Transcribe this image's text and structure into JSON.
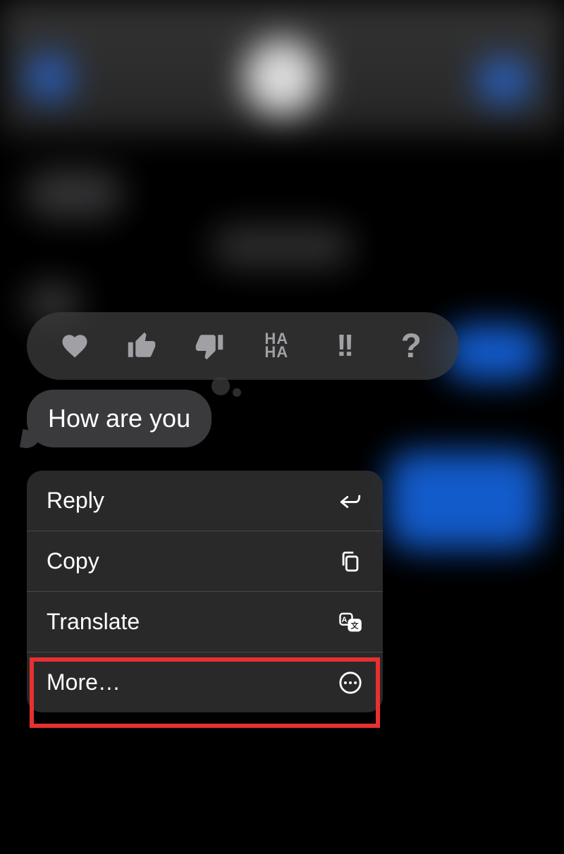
{
  "message": {
    "text": "How are you"
  },
  "reactions": {
    "heart": "heart-icon",
    "thumbs_up": "thumbs-up-icon",
    "thumbs_down": "thumbs-down-icon",
    "haha_line1": "HA",
    "haha_line2": "HA",
    "exclaim": "!!",
    "question": "?"
  },
  "menu": {
    "items": [
      {
        "label": "Reply",
        "icon": "reply-icon"
      },
      {
        "label": "Copy",
        "icon": "copy-icon"
      },
      {
        "label": "Translate",
        "icon": "translate-icon"
      },
      {
        "label": "More…",
        "icon": "more-icon"
      }
    ]
  }
}
